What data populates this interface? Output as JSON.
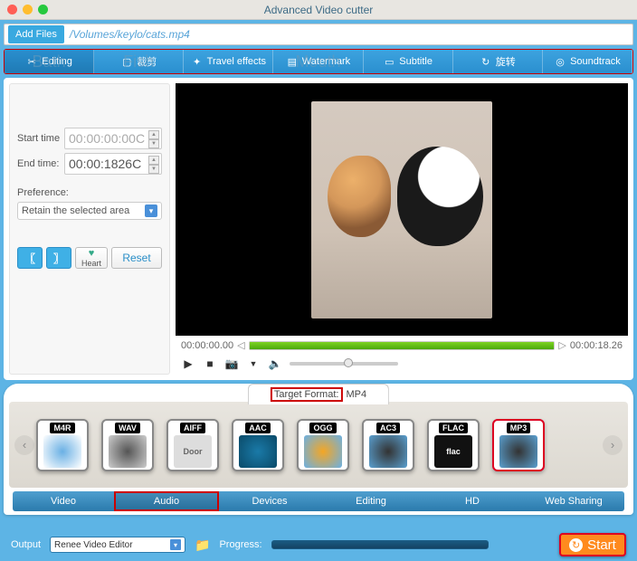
{
  "window": {
    "title": "Advanced Video cutter"
  },
  "toolbar": {
    "add_files": "Add Files",
    "filepath": "/Volumes/keylo/cats.mp4"
  },
  "tabs": {
    "items": [
      {
        "label": "Editing",
        "ghost": "Bath"
      },
      {
        "label": "裁剪",
        "ghost": "Fish"
      },
      {
        "label": "Travel effects",
        "ghost": ""
      },
      {
        "label": "Watermark",
        "ghost": "Mouth"
      },
      {
        "label": "Subtitle",
        "ghost": ""
      },
      {
        "label": "旋转",
        "ghost": ""
      },
      {
        "label": "Soundtrack",
        "ghost": ""
      }
    ]
  },
  "editpanel": {
    "start_label": "Start time",
    "start_value": "00:00:00:00C",
    "end_label": "End time:",
    "end_value": "00:00:1826C",
    "preference_label": "Preference:",
    "preference_value": "Retain the selected area",
    "mark_in": "〖",
    "mark_out": "〗",
    "heart_label": "Heart",
    "reset_label": "Reset"
  },
  "player": {
    "pos": "00:00:00.00",
    "dur": "00:00:18.26"
  },
  "format": {
    "target_label": "Target Format:",
    "target_value": "MP4",
    "items": [
      "M4R",
      "WAV",
      "AIFF",
      "AAC",
      "OGG",
      "AC3",
      "FLAC",
      "MP3"
    ],
    "aiff_sub": "Door",
    "categories": [
      "Video",
      "Audio",
      "Devices",
      "Editing",
      "HD",
      "Web Sharing"
    ]
  },
  "bottom": {
    "output_label": "Output",
    "output_value": "Renee Video Editor",
    "progress_label": "Progress:",
    "start_label": "Start"
  }
}
